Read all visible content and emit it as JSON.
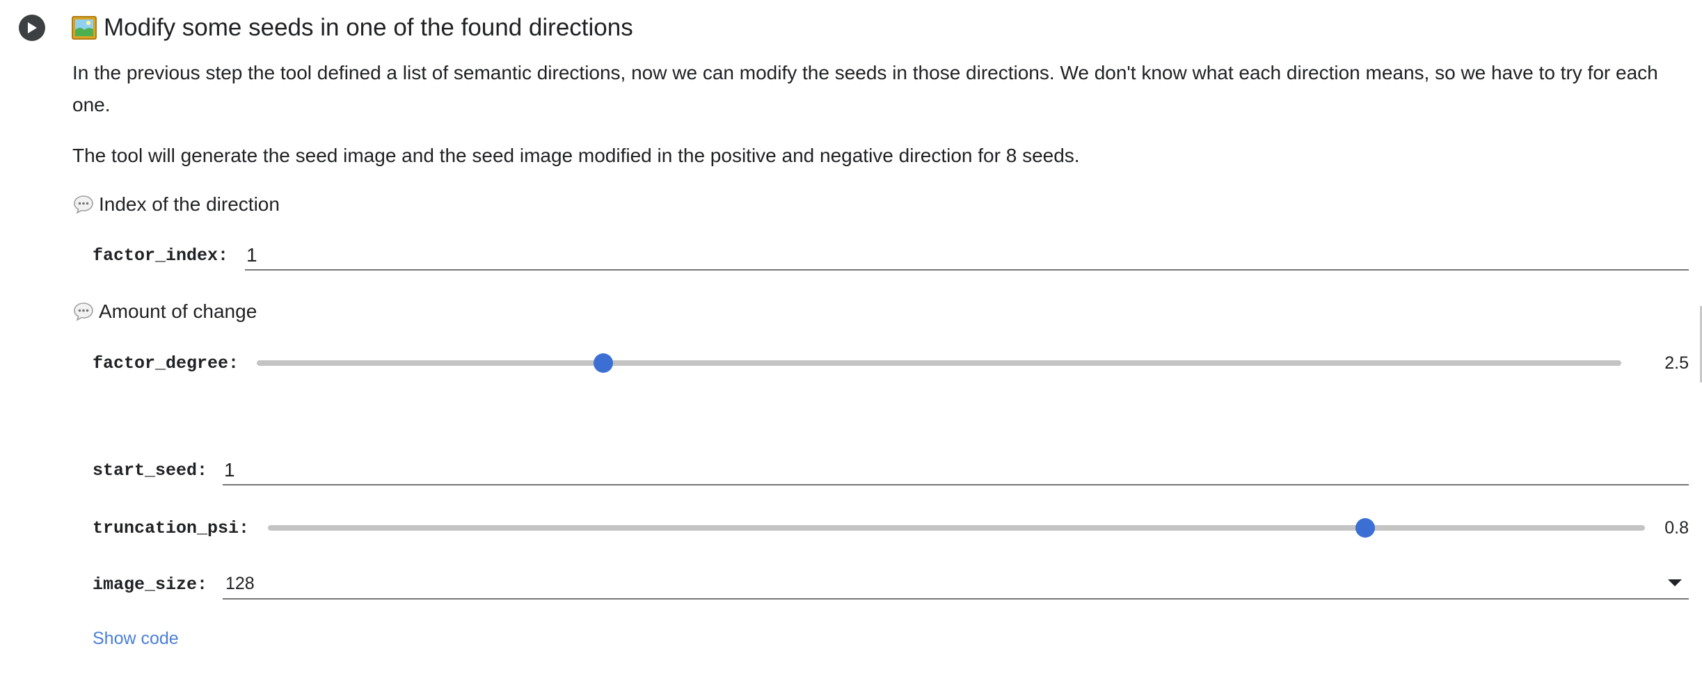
{
  "cell": {
    "title": "Modify some seeds in one of the found directions",
    "title_icon": "framed-picture-icon",
    "paragraphs": [
      "In the previous step the tool defined a list of semantic directions, now we can modify the seeds in those directions. We don't know what each direction means, so we have to try for each one.",
      "The tool will generate the seed image and the seed image modified in the positive and negative direction for 8 seeds."
    ]
  },
  "form": {
    "section_direction": "Index of the direction",
    "factor_index": {
      "label": "factor_index:",
      "value": "1"
    },
    "section_change": "Amount of change",
    "factor_degree": {
      "label": "factor_degree:",
      "value": "2.5",
      "fraction": 0.254
    },
    "start_seed": {
      "label": "start_seed:",
      "value": "1"
    },
    "truncation_psi": {
      "label": "truncation_psi:",
      "value": "0.8",
      "fraction": 0.797
    },
    "image_size": {
      "label": "image_size:",
      "value": "128"
    }
  },
  "show_code_label": "Show code",
  "colors": {
    "accent": "#3b6fd4",
    "link": "#4a7fd8",
    "track": "#c4c4c4",
    "run_button": "#3c4043"
  }
}
